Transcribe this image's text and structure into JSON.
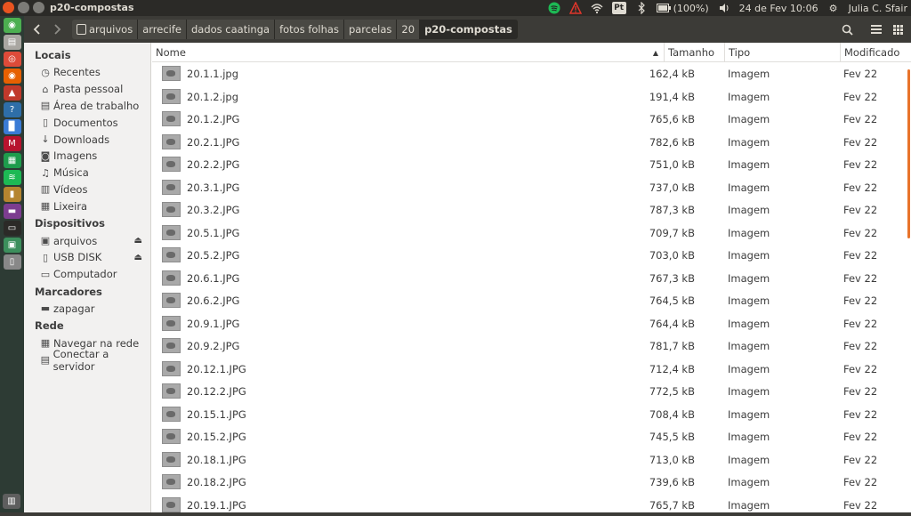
{
  "window_title": "p20-compostas",
  "tray": {
    "keyboard": "Pt",
    "battery": "(100%)",
    "datetime": "24 de Fev 10:06",
    "user": "Julia C. Sfair"
  },
  "toolbar": {
    "back_icon": "chevron-left-icon",
    "forward_icon": "chevron-right-icon",
    "breadcrumbs": [
      "arquivos",
      "arrecife",
      "dados caatinga",
      "fotos folhas",
      "parcelas",
      "20",
      "p20-compostas"
    ],
    "search_icon": "search-icon",
    "menu_icon": "hamburger-icon",
    "grid_icon": "grid-view-icon"
  },
  "sidebar": {
    "sections": [
      {
        "title": "Locais",
        "items": [
          {
            "label": "Recentes",
            "icon": "clock-icon"
          },
          {
            "label": "Pasta pessoal",
            "icon": "home-icon"
          },
          {
            "label": "Área de trabalho",
            "icon": "desktop-icon"
          },
          {
            "label": "Documentos",
            "icon": "document-icon"
          },
          {
            "label": "Downloads",
            "icon": "download-icon"
          },
          {
            "label": "Imagens",
            "icon": "camera-icon"
          },
          {
            "label": "Música",
            "icon": "music-icon"
          },
          {
            "label": "Vídeos",
            "icon": "film-icon"
          },
          {
            "label": "Lixeira",
            "icon": "trash-icon"
          }
        ]
      },
      {
        "title": "Dispositivos",
        "items": [
          {
            "label": "arquivos",
            "icon": "drive-icon",
            "eject": true
          },
          {
            "label": "USB DISK",
            "icon": "usb-icon",
            "eject": true
          },
          {
            "label": "Computador",
            "icon": "computer-icon"
          }
        ]
      },
      {
        "title": "Marcadores",
        "items": [
          {
            "label": "zapagar",
            "icon": "folder-icon"
          }
        ]
      },
      {
        "title": "Rede",
        "items": [
          {
            "label": "Navegar na rede",
            "icon": "network-icon"
          },
          {
            "label": "Conectar a servidor",
            "icon": "server-icon"
          }
        ]
      }
    ]
  },
  "columns": {
    "name": "Nome",
    "size": "Tamanho",
    "type": "Tipo",
    "modified": "Modificado"
  },
  "files": [
    {
      "name": "20.1.1.jpg",
      "size": "162,4 kB",
      "type": "Imagem",
      "modified": "Fev 22"
    },
    {
      "name": "20.1.2.jpg",
      "size": "191,4 kB",
      "type": "Imagem",
      "modified": "Fev 22"
    },
    {
      "name": "20.1.2.JPG",
      "size": "765,6 kB",
      "type": "Imagem",
      "modified": "Fev 22"
    },
    {
      "name": "20.2.1.JPG",
      "size": "782,6 kB",
      "type": "Imagem",
      "modified": "Fev 22"
    },
    {
      "name": "20.2.2.JPG",
      "size": "751,0 kB",
      "type": "Imagem",
      "modified": "Fev 22"
    },
    {
      "name": "20.3.1.JPG",
      "size": "737,0 kB",
      "type": "Imagem",
      "modified": "Fev 22"
    },
    {
      "name": "20.3.2.JPG",
      "size": "787,3 kB",
      "type": "Imagem",
      "modified": "Fev 22"
    },
    {
      "name": "20.5.1.JPG",
      "size": "709,7 kB",
      "type": "Imagem",
      "modified": "Fev 22"
    },
    {
      "name": "20.5.2.JPG",
      "size": "703,0 kB",
      "type": "Imagem",
      "modified": "Fev 22"
    },
    {
      "name": "20.6.1.JPG",
      "size": "767,3 kB",
      "type": "Imagem",
      "modified": "Fev 22"
    },
    {
      "name": "20.6.2.JPG",
      "size": "764,5 kB",
      "type": "Imagem",
      "modified": "Fev 22"
    },
    {
      "name": "20.9.1.JPG",
      "size": "764,4 kB",
      "type": "Imagem",
      "modified": "Fev 22"
    },
    {
      "name": "20.9.2.JPG",
      "size": "781,7 kB",
      "type": "Imagem",
      "modified": "Fev 22"
    },
    {
      "name": "20.12.1.JPG",
      "size": "712,4 kB",
      "type": "Imagem",
      "modified": "Fev 22"
    },
    {
      "name": "20.12.2.JPG",
      "size": "772,5 kB",
      "type": "Imagem",
      "modified": "Fev 22"
    },
    {
      "name": "20.15.1.JPG",
      "size": "708,4 kB",
      "type": "Imagem",
      "modified": "Fev 22"
    },
    {
      "name": "20.15.2.JPG",
      "size": "745,5 kB",
      "type": "Imagem",
      "modified": "Fev 22"
    },
    {
      "name": "20.18.1.JPG",
      "size": "713,0 kB",
      "type": "Imagem",
      "modified": "Fev 22"
    },
    {
      "name": "20.18.2.JPG",
      "size": "739,6 kB",
      "type": "Imagem",
      "modified": "Fev 22"
    },
    {
      "name": "20.19.1.JPG",
      "size": "765,7 kB",
      "type": "Imagem",
      "modified": "Fev 22"
    }
  ],
  "colors": {
    "accent": "#e8742b",
    "panel": "#3c3b37",
    "sidebar": "#f2f1f0"
  }
}
